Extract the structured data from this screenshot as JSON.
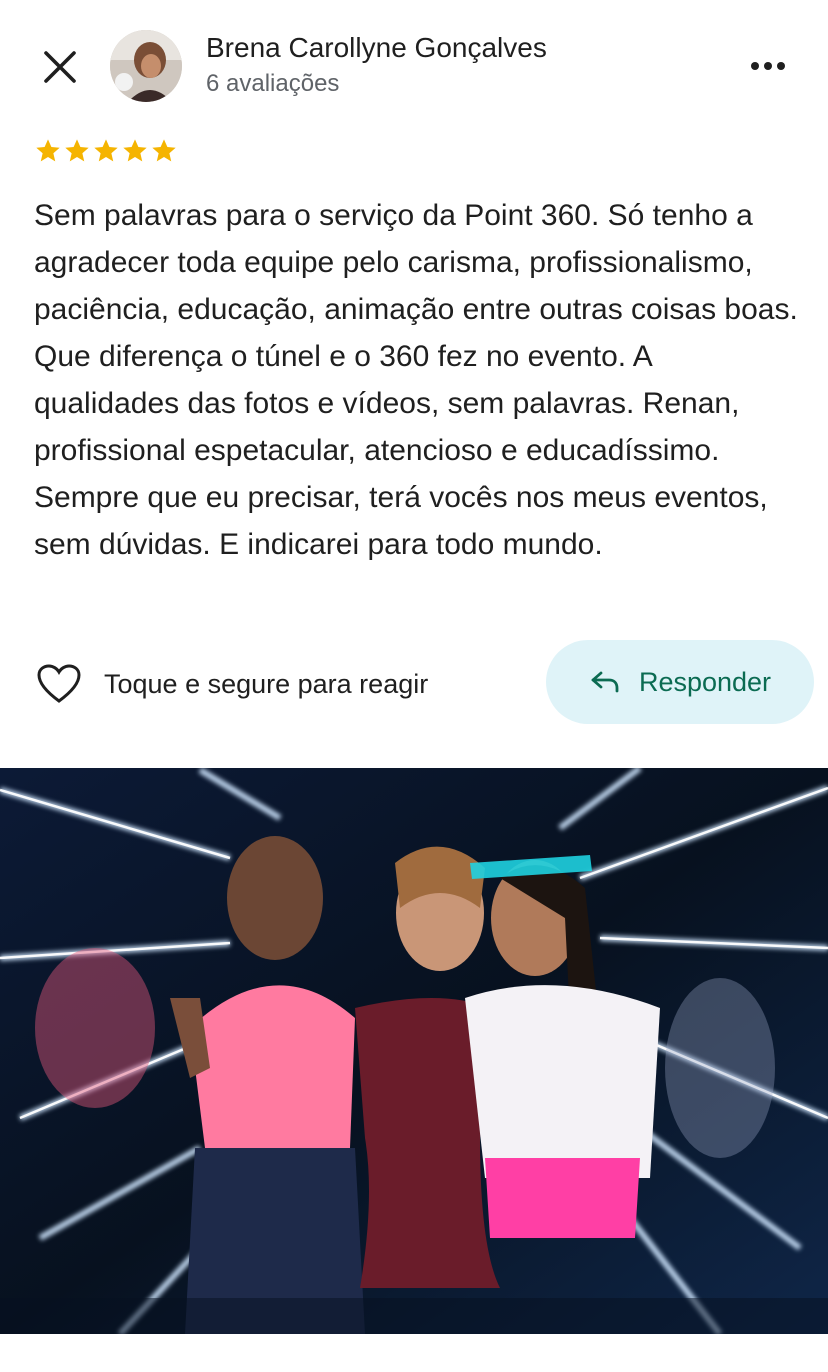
{
  "header": {
    "close_icon": "close-icon",
    "avatar_icon": "avatar",
    "reviewer_name": "Brena Carollyne Gonçalves",
    "review_count": "6 avaliações",
    "more_icon": "more-options-icon"
  },
  "rating": {
    "stars": 5,
    "max": 5,
    "color": "#f5b400"
  },
  "review_text": "Sem palavras para o serviço da Point 360. Só tenho a agradecer toda equipe pelo carisma, profissionalismo, paciência, educação, animação entre outras coisas boas. Que diferença o túnel e o 360 fez no evento. A qualidades das fotos e vídeos, sem palavras. Renan, profissional espetacular, atencioso e educadíssimo. Sempre que eu precisar, terá vocês nos meus eventos, sem dúvidas. E indicarei para todo mundo.",
  "actions": {
    "react_icon": "heart-icon",
    "react_label": "Toque e segure para reagir",
    "reply_icon": "reply-arrow-icon",
    "reply_label": "Responder"
  },
  "photo": {
    "description_icon": "review-photo"
  },
  "colors": {
    "accent": "#0b6b52",
    "reply_bg": "#dff3f8",
    "secondary_text": "#5f6368"
  }
}
